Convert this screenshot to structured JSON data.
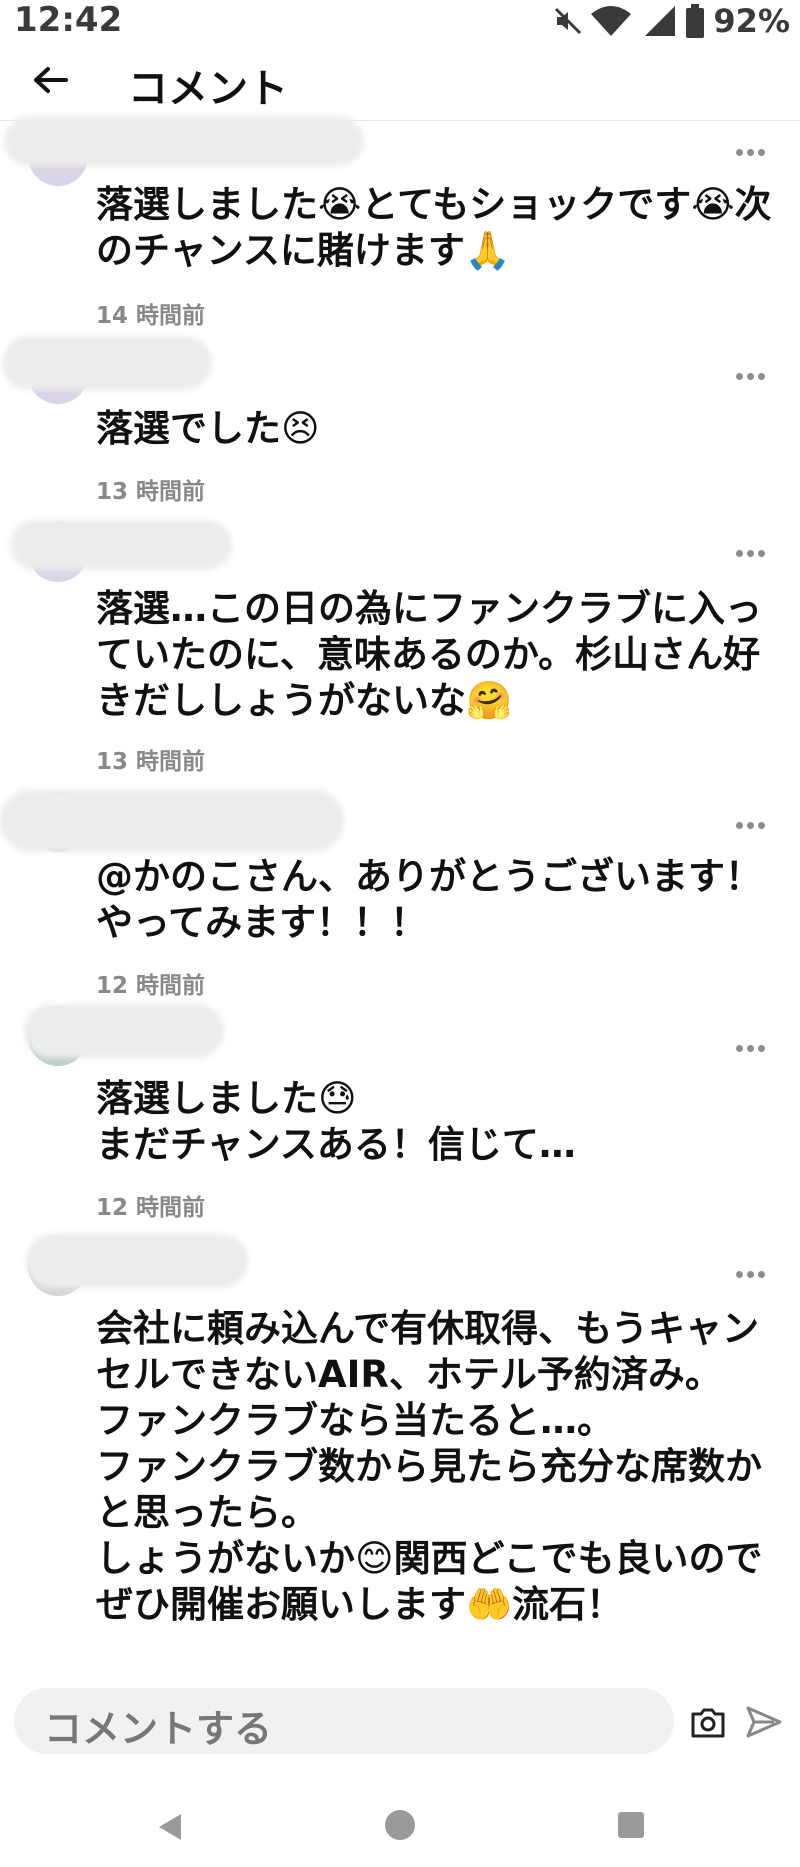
{
  "status": {
    "time": "12:42",
    "battery": "92%"
  },
  "header": {
    "title": "コメント"
  },
  "comments": [
    {
      "text": "落選しました😭とてもショックです😭次のチャンスに賭けます🙏",
      "time": "14 時間前"
    },
    {
      "text": "落選でした😣",
      "time": "13 時間前"
    },
    {
      "text": "落選…この日の為にファンクラブに入っていたのに、意味あるのか。杉山さん好きだししょうがないな🤗",
      "time": "13 時間前"
    },
    {
      "text": "@かのこさん、ありがとうございます！やってみます！！！",
      "time": "12 時間前"
    },
    {
      "text": "落選しました😓\nまだチャンスある！信じて…",
      "time": "12 時間前"
    },
    {
      "text": "会社に頼み込んで有休取得、もうキャンセルできないAIR、ホテル予約済み。\nファンクラブなら当たると…。\nファンクラブ数から見たら充分な席数かと思ったら。\nしょうがないか😊関西どこでも良いのでぜひ開催お願いします🤲流石！",
      "time": ""
    }
  ],
  "input": {
    "placeholder": "コメントする"
  },
  "icons": {
    "back": "arrow-left-icon",
    "more": "more-dots-icon",
    "camera": "camera-icon",
    "send": "send-icon"
  },
  "colors": {
    "timestamp": "#888888",
    "input_bg": "#f1f1f1"
  }
}
